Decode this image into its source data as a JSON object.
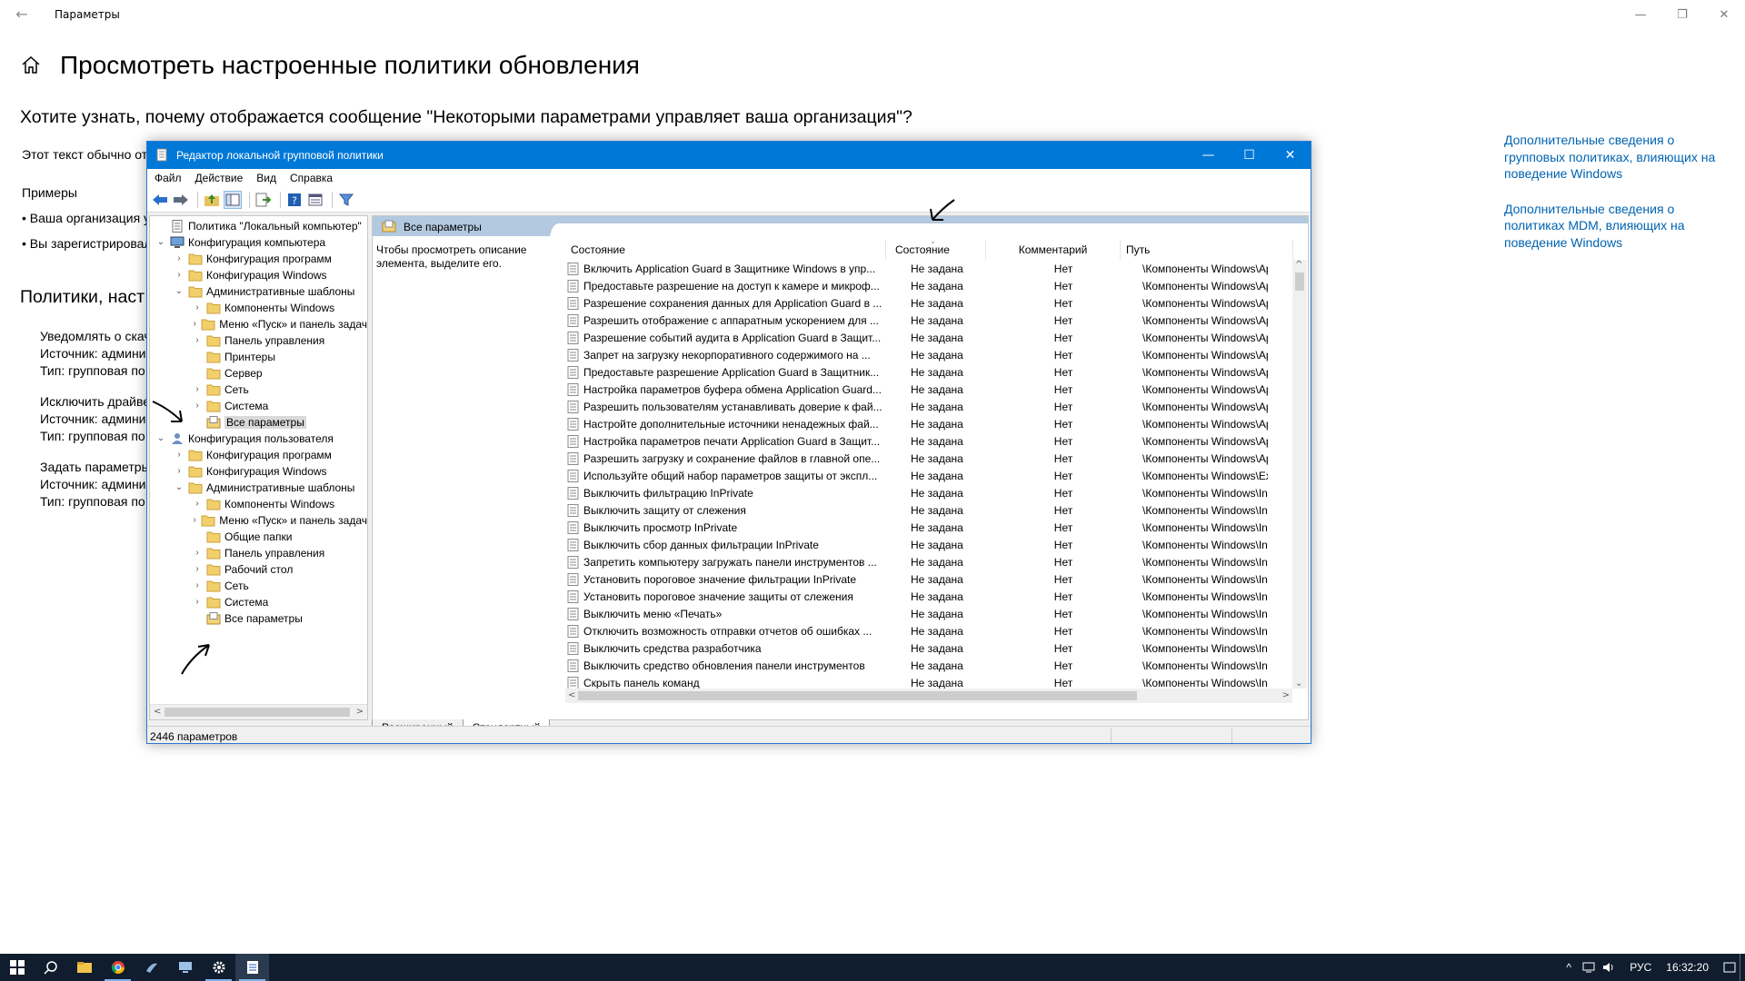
{
  "settings": {
    "app_title": "Параметры",
    "page_title": "Просмотреть настроенные политики обновления",
    "question": "Хотите узнать, почему отображается сообщение \"Некоторыми параметрами управляет ваша организация\"?",
    "intro_text": "Этот текст обычно от",
    "examples_heading": "Примеры",
    "example_1": "• Ваша организация у",
    "example_2": "• Вы зарегистрировал",
    "policies_heading": "Политики, наст",
    "policies": [
      {
        "name": "Уведомлять о скач",
        "source": "Источник: админи",
        "type": "Тип: групповая по"
      },
      {
        "name": "Исключить драйве",
        "source": "Источник: админи",
        "type": "Тип: групповая по"
      },
      {
        "name": "Задать параметры",
        "source": "Источник: админи",
        "type": "Тип: групповая по"
      }
    ],
    "links": [
      "Дополнительные сведения о групповых политиках, влияющих на поведение Windows",
      "Дополнительные сведения о политиках MDM, влияющих на поведение Windows"
    ],
    "accent_color": "#0063b1"
  },
  "gpedit": {
    "title": "Редактор локальной групповой политики",
    "menu": [
      "Файл",
      "Действие",
      "Вид",
      "Справка"
    ],
    "tree": [
      {
        "label": "Политика \"Локальный компьютер\"",
        "level": 0,
        "exp": "",
        "icon": "policy-doc"
      },
      {
        "label": "Конфигурация компьютера",
        "level": 1,
        "exp": "⌄",
        "icon": "computer"
      },
      {
        "label": "Конфигурация программ",
        "level": 2,
        "exp": "›",
        "icon": "folder"
      },
      {
        "label": "Конфигурация Windows",
        "level": 2,
        "exp": "›",
        "icon": "folder"
      },
      {
        "label": "Административные шаблоны",
        "level": 2,
        "exp": "⌄",
        "icon": "folder"
      },
      {
        "label": "Компоненты Windows",
        "level": 3,
        "exp": "›",
        "icon": "folder"
      },
      {
        "label": "Меню «Пуск» и панель задач",
        "level": 3,
        "exp": "›",
        "icon": "folder"
      },
      {
        "label": "Панель управления",
        "level": 3,
        "exp": "›",
        "icon": "folder"
      },
      {
        "label": "Принтеры",
        "level": 3,
        "exp": "",
        "icon": "folder"
      },
      {
        "label": "Сервер",
        "level": 3,
        "exp": "",
        "icon": "folder"
      },
      {
        "label": "Сеть",
        "level": 3,
        "exp": "›",
        "icon": "folder"
      },
      {
        "label": "Система",
        "level": 3,
        "exp": "›",
        "icon": "folder"
      },
      {
        "label": "Все параметры",
        "level": 3,
        "exp": "",
        "icon": "all-settings",
        "selected": true
      },
      {
        "label": "Конфигурация пользователя",
        "level": 1,
        "exp": "⌄",
        "icon": "user"
      },
      {
        "label": "Конфигурация программ",
        "level": 2,
        "exp": "›",
        "icon": "folder"
      },
      {
        "label": "Конфигурация Windows",
        "level": 2,
        "exp": "›",
        "icon": "folder"
      },
      {
        "label": "Административные шаблоны",
        "level": 2,
        "exp": "⌄",
        "icon": "folder"
      },
      {
        "label": "Компоненты Windows",
        "level": 3,
        "exp": "›",
        "icon": "folder"
      },
      {
        "label": "Меню «Пуск» и панель задач",
        "level": 3,
        "exp": "›",
        "icon": "folder"
      },
      {
        "label": "Общие папки",
        "level": 3,
        "exp": "",
        "icon": "folder"
      },
      {
        "label": "Панель управления",
        "level": 3,
        "exp": "›",
        "icon": "folder"
      },
      {
        "label": "Рабочий стол",
        "level": 3,
        "exp": "›",
        "icon": "folder"
      },
      {
        "label": "Сеть",
        "level": 3,
        "exp": "›",
        "icon": "folder"
      },
      {
        "label": "Система",
        "level": 3,
        "exp": "›",
        "icon": "folder"
      },
      {
        "label": "Все параметры",
        "level": 3,
        "exp": "",
        "icon": "all-settings"
      }
    ],
    "pane_header": "Все параметры",
    "description": "Чтобы просмотреть описание элемента, выделите его.",
    "columns": {
      "name": "Состояние",
      "state": "Состояние",
      "comment": "Комментарий",
      "path": "Путь"
    },
    "rows": [
      {
        "name": "Включить Application Guard в Защитнике Windows в упр...",
        "state": "Не задана",
        "comment": "Нет",
        "path": "\\Компоненты Windows\\Ap"
      },
      {
        "name": "Предоставьте разрешение на доступ к камере и микроф...",
        "state": "Не задана",
        "comment": "Нет",
        "path": "\\Компоненты Windows\\Ap"
      },
      {
        "name": "Разрешение сохранения данных для Application Guard в ...",
        "state": "Не задана",
        "comment": "Нет",
        "path": "\\Компоненты Windows\\Ap"
      },
      {
        "name": "Разрешить отображение с аппаратным ускорением для ...",
        "state": "Не задана",
        "comment": "Нет",
        "path": "\\Компоненты Windows\\Ap"
      },
      {
        "name": "Разрешение событий аудита в Application Guard в Защит...",
        "state": "Не задана",
        "comment": "Нет",
        "path": "\\Компоненты Windows\\Ap"
      },
      {
        "name": "Запрет на загрузку некорпоративного содержимого на ...",
        "state": "Не задана",
        "comment": "Нет",
        "path": "\\Компоненты Windows\\Ap"
      },
      {
        "name": "Предоставьте разрешение Application Guard в Защитник...",
        "state": "Не задана",
        "comment": "Нет",
        "path": "\\Компоненты Windows\\Ap"
      },
      {
        "name": "Настройка параметров буфера обмена Application Guard...",
        "state": "Не задана",
        "comment": "Нет",
        "path": "\\Компоненты Windows\\Ap"
      },
      {
        "name": "Разрешить пользователям устанавливать доверие к фай...",
        "state": "Не задана",
        "comment": "Нет",
        "path": "\\Компоненты Windows\\Ap"
      },
      {
        "name": "Настройте дополнительные источники ненадежных фай...",
        "state": "Не задана",
        "comment": "Нет",
        "path": "\\Компоненты Windows\\Ap"
      },
      {
        "name": "Настройка параметров печати Application Guard в Защит...",
        "state": "Не задана",
        "comment": "Нет",
        "path": "\\Компоненты Windows\\Ap"
      },
      {
        "name": "Разрешить загрузку и сохранение файлов в главной опе...",
        "state": "Не задана",
        "comment": "Нет",
        "path": "\\Компоненты Windows\\Ap"
      },
      {
        "name": "Используйте общий набор параметров защиты от экспл...",
        "state": "Не задана",
        "comment": "Нет",
        "path": "\\Компоненты Windows\\Ex"
      },
      {
        "name": "Выключить фильтрацию InPrivate",
        "state": "Не задана",
        "comment": "Нет",
        "path": "\\Компоненты Windows\\In"
      },
      {
        "name": "Выключить защиту от слежения",
        "state": "Не задана",
        "comment": "Нет",
        "path": "\\Компоненты Windows\\In"
      },
      {
        "name": "Выключить просмотр InPrivate",
        "state": "Не задана",
        "comment": "Нет",
        "path": "\\Компоненты Windows\\In"
      },
      {
        "name": "Выключить сбор данных фильтрации InPrivate",
        "state": "Не задана",
        "comment": "Нет",
        "path": "\\Компоненты Windows\\In"
      },
      {
        "name": "Запретить компьютеру загружать панели инструментов ...",
        "state": "Не задана",
        "comment": "Нет",
        "path": "\\Компоненты Windows\\In"
      },
      {
        "name": "Установить пороговое значение фильтрации InPrivate",
        "state": "Не задана",
        "comment": "Нет",
        "path": "\\Компоненты Windows\\In"
      },
      {
        "name": "Установить пороговое значение защиты от слежения",
        "state": "Не задана",
        "comment": "Нет",
        "path": "\\Компоненты Windows\\In"
      },
      {
        "name": "Выключить меню «Печать»",
        "state": "Не задана",
        "comment": "Нет",
        "path": "\\Компоненты Windows\\In"
      },
      {
        "name": "Отключить возможность отправки отчетов об ошибках ...",
        "state": "Не задана",
        "comment": "Нет",
        "path": "\\Компоненты Windows\\In"
      },
      {
        "name": "Выключить средства разработчика",
        "state": "Не задана",
        "comment": "Нет",
        "path": "\\Компоненты Windows\\In"
      },
      {
        "name": "Выключить средство обновления панели инструментов",
        "state": "Не задана",
        "comment": "Нет",
        "path": "\\Компоненты Windows\\In"
      },
      {
        "name": "Скрыть панель команд",
        "state": "Не задана",
        "comment": "Нет",
        "path": "\\Компоненты Windows\\In"
      }
    ],
    "tabs": [
      "Расширенный",
      "Стандартный"
    ],
    "status": "2446 параметров",
    "title_color": "#0078d7"
  },
  "taskbar": {
    "lang": "РУС",
    "time": "16:32:20",
    "apps": [
      "windows-start-icon",
      "search-icon",
      "file-explorer-icon",
      "chrome-icon",
      "app-icon",
      "remote-desktop-icon",
      "settings-gear-icon",
      "gpedit-icon"
    ]
  }
}
